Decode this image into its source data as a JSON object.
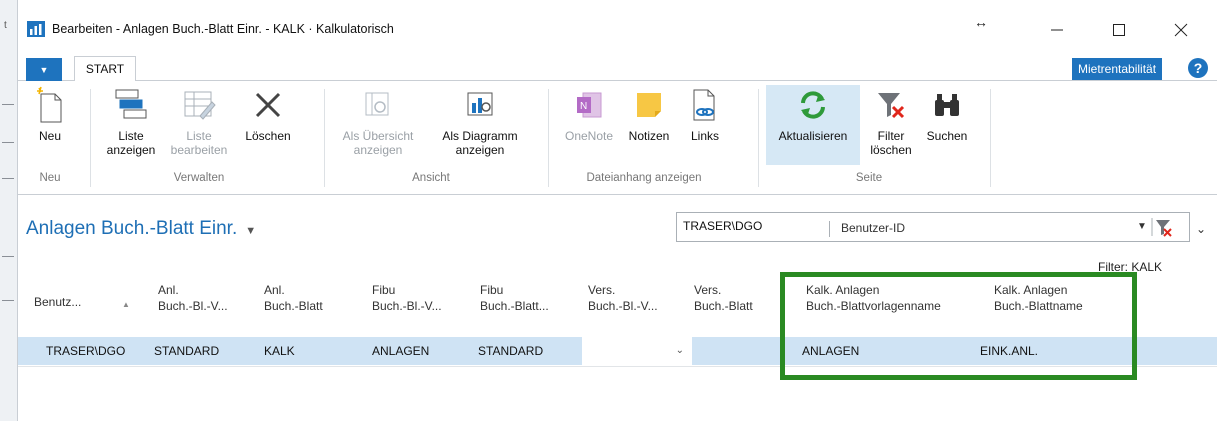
{
  "window": {
    "title": "Bearbeiten - Anlagen Buch.-Blatt Einr. - KALK · Kalkulatorisch",
    "resize_glyph": "↔"
  },
  "tabs": {
    "app_menu": "▼",
    "start": "START",
    "mietrentabilitaet": "Mietrentabilität",
    "help": "?"
  },
  "ribbon": {
    "neu": {
      "label1": "Neu",
      "label2": ""
    },
    "liste_anzeigen": {
      "label1": "Liste",
      "label2": "anzeigen"
    },
    "liste_bearbeiten": {
      "label1": "Liste",
      "label2": "bearbeiten"
    },
    "loeschen": {
      "label1": "Löschen",
      "label2": ""
    },
    "als_uebersicht": {
      "label1": "Als Übersicht",
      "label2": "anzeigen"
    },
    "als_diagramm": {
      "label1": "Als Diagramm",
      "label2": "anzeigen"
    },
    "onenote": {
      "label1": "OneNote",
      "label2": ""
    },
    "notizen": {
      "label1": "Notizen",
      "label2": ""
    },
    "links": {
      "label1": "Links",
      "label2": ""
    },
    "aktualisieren": {
      "label1": "Aktualisieren",
      "label2": ""
    },
    "filter_loeschen": {
      "label1": "Filter",
      "label2": "löschen"
    },
    "suchen": {
      "label1": "Suchen",
      "label2": ""
    },
    "groups": {
      "neu": "Neu",
      "verwalten": "Verwalten",
      "ansicht": "Ansicht",
      "dateianhang": "Dateianhang anzeigen",
      "seite": "Seite"
    }
  },
  "page": {
    "title": "Anlagen Buch.-Blatt Einr.",
    "title_dropdown": "▼",
    "filter_value": "TRASER\\DGO",
    "filter_field": "Benutzer-ID",
    "filter_note": "Filter: KALK"
  },
  "columns": [
    {
      "line1": "Benutz...",
      "line2": ""
    },
    {
      "line1": "Anl.",
      "line2": "Buch.-Bl.-V..."
    },
    {
      "line1": "Anl.",
      "line2": "Buch.-Blatt"
    },
    {
      "line1": "Fibu",
      "line2": "Buch.-Bl.-V..."
    },
    {
      "line1": "Fibu",
      "line2": "Buch.-Blatt..."
    },
    {
      "line1": "Vers.",
      "line2": "Buch.-Bl.-V..."
    },
    {
      "line1": "Vers.",
      "line2": "Buch.-Blatt"
    },
    {
      "line1": "Kalk. Anlagen",
      "line2": "Buch.-Blattvorlagenname"
    },
    {
      "line1": "Kalk. Anlagen",
      "line2": "Buch.-Blattname"
    }
  ],
  "rows": [
    {
      "benutzer": "TRASER\\DGO",
      "anl_vorlage": "STANDARD",
      "anl_blatt": "KALK",
      "fibu_vorlage": "ANLAGEN",
      "fibu_blatt": "STANDARD",
      "vers_vorlage": "",
      "vers_blatt": "",
      "kalk_vorlage": "ANLAGEN",
      "kalk_blatt": "EINK.ANL."
    }
  ],
  "colors": {
    "accent": "#1e73be",
    "row_selected": "#cfe3f4",
    "highlight_box": "#2a8a22"
  }
}
